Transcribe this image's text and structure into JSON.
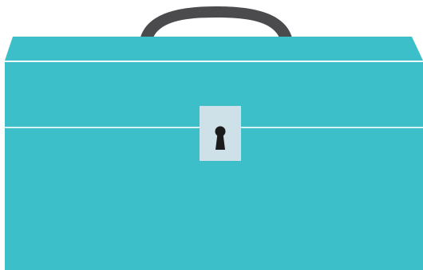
{
  "illustration": {
    "subject": "toolbox-icon",
    "colors": {
      "body": "#3dbfc9",
      "body_line": "#e8f7f8",
      "handle": "#4b4b4d",
      "lock_plate": "#cfe1e8",
      "keyhole": "#1b1b1b",
      "background": "#ffffff"
    }
  }
}
